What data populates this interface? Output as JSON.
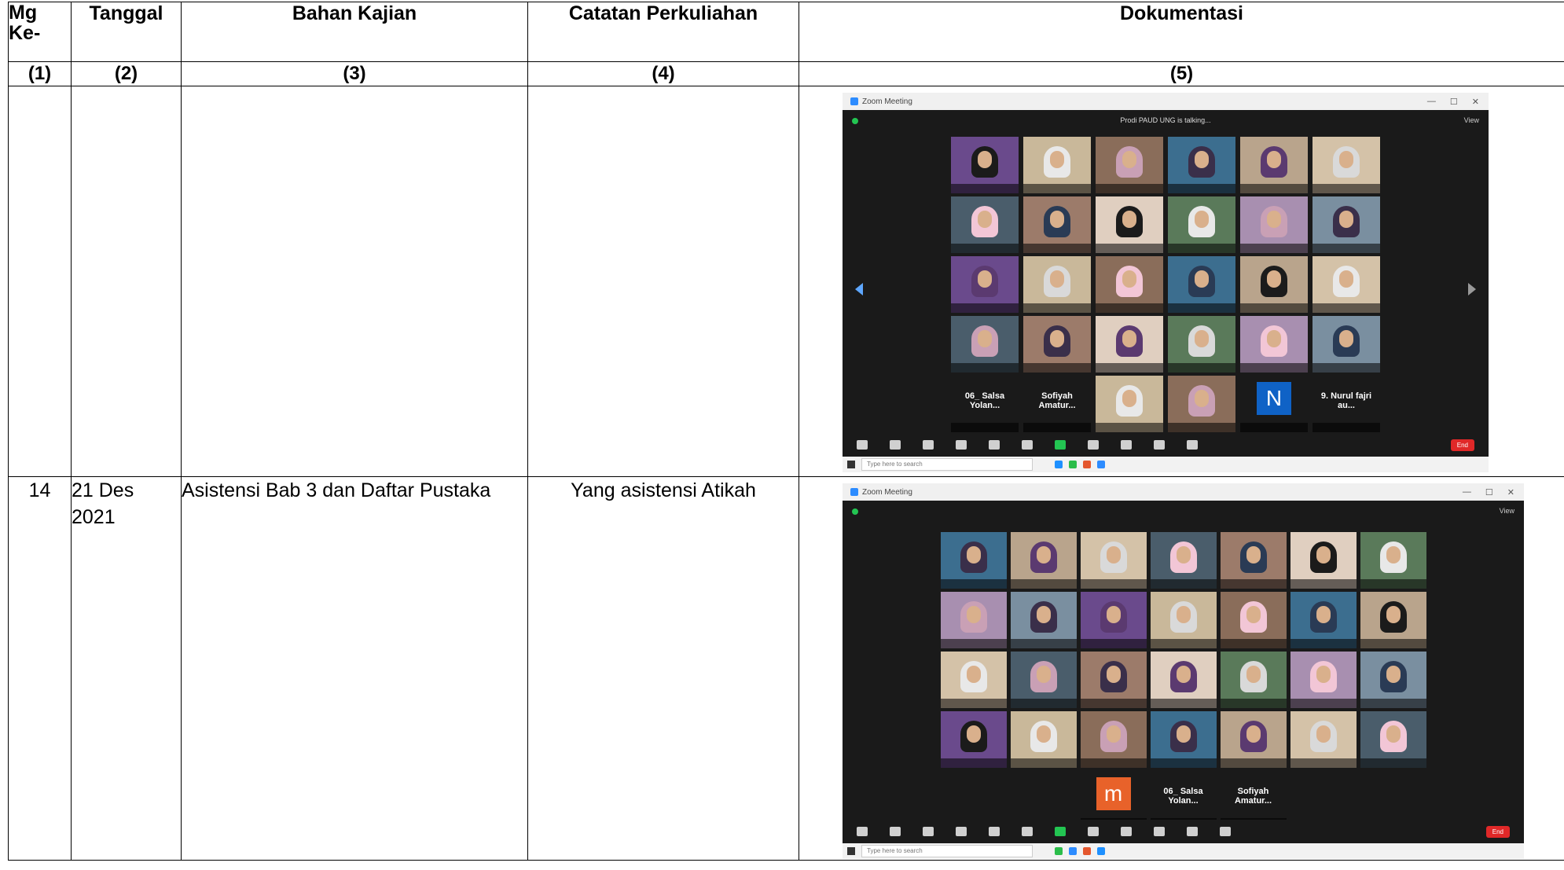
{
  "table": {
    "headers": [
      "Mg Ke-",
      "Tanggal",
      "Bahan Kajian",
      "Catatan Perkuliahan",
      "Dokumentasi"
    ],
    "numbers": [
      "(1)",
      "(2)",
      "(3)",
      "(4)",
      "(5)"
    ],
    "rows": [
      {
        "mg": "",
        "tanggal": "",
        "bahan": "",
        "catatan": ""
      },
      {
        "mg": "14",
        "tanggal": "21 Des 2021",
        "bahan": "Asistensi Bab 3 dan Daftar Pustaka",
        "catatan": "Yang asistensi Atikah"
      }
    ]
  },
  "screenshots": [
    {
      "title": "Zoom Meeting",
      "talking": "Prodi PAUD UNG is talking...",
      "view_label": "View",
      "end_label": "End",
      "search_placeholder": "Type here to search",
      "text_tiles": [
        "06_ Salsa Yolan...",
        "Sofiyah Amatur...",
        "9. Nurul fajri au..."
      ],
      "letter_tile": "N",
      "colors": {
        "bg": "#1a1a1a",
        "letter_tile": "#0f62c6",
        "end": "#e02828"
      }
    },
    {
      "title": "Zoom Meeting",
      "view_label": "View",
      "end_label": "End",
      "search_placeholder": "Type here to search",
      "text_tiles": [
        "06_ Salsa Yolan...",
        "Sofiyah Amatur..."
      ],
      "letter_tile": "m",
      "colors": {
        "bg": "#1a1a1a",
        "letter_tile": "#e8622a",
        "end": "#e02828"
      }
    }
  ]
}
